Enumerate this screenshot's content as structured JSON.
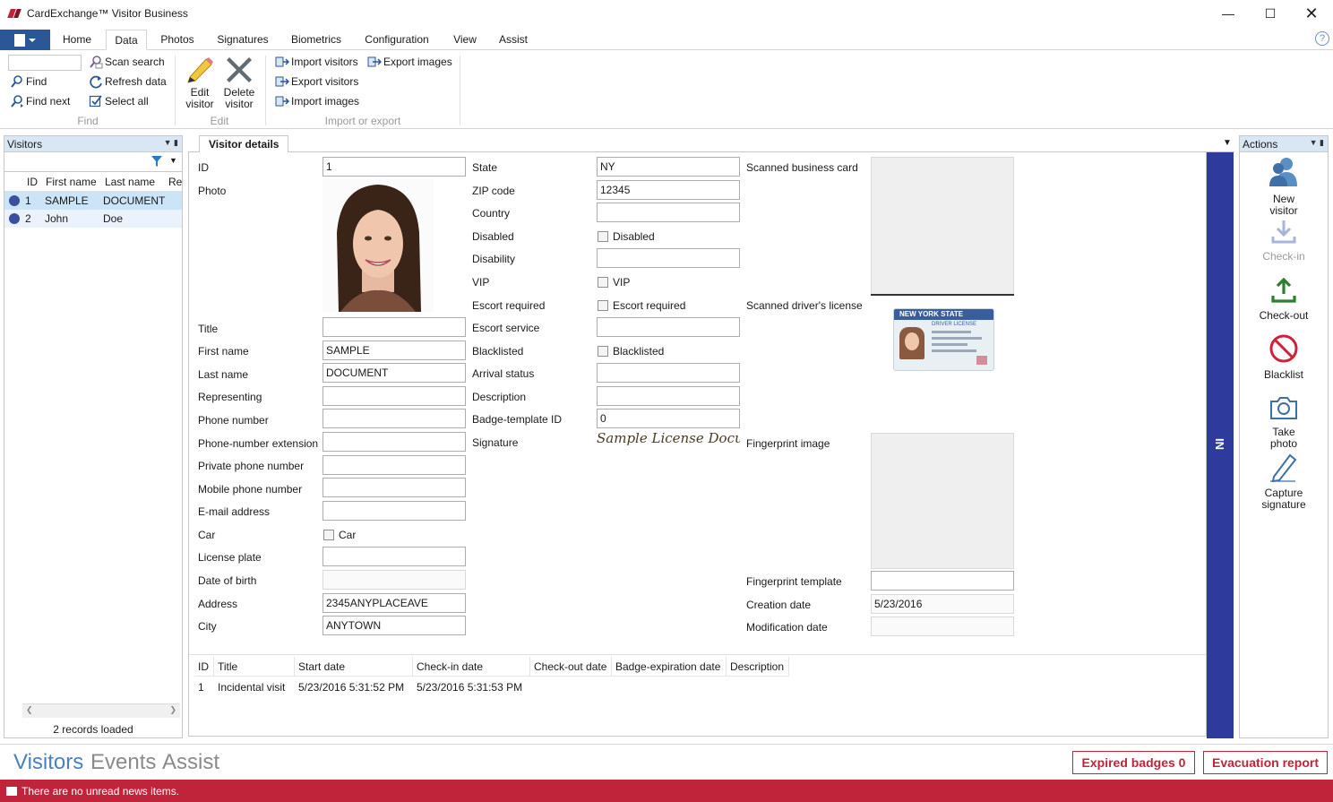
{
  "window": {
    "title": "CardExchange™ Visitor Business"
  },
  "ribbon_tabs": [
    "Home",
    "Data",
    "Photos",
    "Signatures",
    "Biometrics",
    "Configuration",
    "View",
    "Assist"
  ],
  "ribbon": {
    "find": {
      "find": "Find",
      "find_next": "Find next",
      "scan_search": "Scan search",
      "refresh_data": "Refresh data",
      "select_all": "Select all",
      "group": "Find"
    },
    "edit": {
      "edit_visitor_1": "Edit",
      "edit_visitor_2": "visitor",
      "delete_visitor_1": "Delete",
      "delete_visitor_2": "visitor",
      "group": "Edit"
    },
    "importexport": {
      "import_visitors": "Import visitors",
      "export_visitors": "Export visitors",
      "import_images": "Import images",
      "export_images": "Export images",
      "group": "Import or export"
    }
  },
  "visitors_pane": {
    "title": "Visitors",
    "columns": [
      "ID",
      "First name",
      "Last name",
      "Re"
    ],
    "rows": [
      {
        "id": "1",
        "first": "SAMPLE",
        "last": "DOCUMENT"
      },
      {
        "id": "2",
        "first": "John",
        "last": "Doe"
      }
    ],
    "records": "2 records loaded"
  },
  "details": {
    "tab": "Visitor details",
    "left": {
      "id_label": "ID",
      "id_value": "1",
      "photo_label": "Photo",
      "title_label": "Title",
      "title_value": "",
      "first_label": "First name",
      "first_value": "SAMPLE",
      "last_label": "Last name",
      "last_value": "DOCUMENT",
      "rep_label": "Representing",
      "rep_value": "",
      "phone_label": "Phone number",
      "phone_value": "",
      "ext_label": "Phone-number extension",
      "ext_value": "",
      "private_label": "Private phone number",
      "private_value": "",
      "mobile_label": "Mobile phone number",
      "mobile_value": "",
      "email_label": "E-mail address",
      "email_value": "",
      "car_label": "Car",
      "car_check": "Car",
      "plate_label": "License plate",
      "plate_value": "",
      "dob_label": "Date of birth",
      "dob_value": "",
      "address_label": "Address",
      "address_value": "2345ANYPLACEAVE",
      "city_label": "City",
      "city_value": "ANYTOWN"
    },
    "middle": {
      "state_label": "State",
      "state_value": "NY",
      "zip_label": "ZIP code",
      "zip_value": "12345",
      "country_label": "Country",
      "country_value": "",
      "disabled_label": "Disabled",
      "disabled_check": "Disabled",
      "disability_label": "Disability",
      "disability_value": "",
      "vip_label": "VIP",
      "vip_check": "VIP",
      "escort_label": "Escort required",
      "escort_check": "Escort required",
      "escort_service_label": "Escort service",
      "escort_service_value": "",
      "blacklisted_label": "Blacklisted",
      "blacklisted_check": "Blacklisted",
      "arrival_label": "Arrival status",
      "arrival_value": "",
      "description_label": "Description",
      "description_value": "",
      "badge_label": "Badge-template ID",
      "badge_value": "0",
      "signature_label": "Signature",
      "signature_text": "Sample License Document"
    },
    "right": {
      "bizcard_label": "Scanned business card",
      "license_label": "Scanned driver's license",
      "license_state": "NEW YORK STATE",
      "license_type": "DRIVER LICENSE",
      "fp_image_label": "Fingerprint image",
      "fp_template_label": "Fingerprint template",
      "fp_template_value": "",
      "creation_label": "Creation date",
      "creation_value": "5/23/2016",
      "modification_label": "Modification date",
      "modification_value": ""
    },
    "events": {
      "columns": [
        "ID",
        "Title",
        "Start date",
        "Check-in date",
        "Check-out date",
        "Badge-expiration date",
        "Description"
      ],
      "row": {
        "id": "1",
        "title": "Incidental visit",
        "start": "5/23/2016 5:31:52 PM",
        "checkin": "5/23/2016 5:31:53 PM"
      }
    },
    "sidebar_text": "NI"
  },
  "actions_pane": {
    "title": "Actions",
    "new_visitor_1": "New",
    "new_visitor_2": "visitor",
    "checkin": "Check-in",
    "checkout": "Check-out",
    "blacklist": "Blacklist",
    "take_photo_1": "Take",
    "take_photo_2": "photo",
    "capture_1": "Capture",
    "capture_2": "signature"
  },
  "bottom_nav": {
    "visitors": "Visitors",
    "events": "Events",
    "assist": "Assist",
    "expired": "Expired badges 0",
    "evacuation": "Evacuation report"
  },
  "status": {
    "message": "There are no unread news items."
  },
  "colors": {
    "accent": "#2b5797",
    "brand_red": "#c0243a",
    "ni_bar": "#2f3b9c",
    "selected_row": "#cce4f7"
  }
}
